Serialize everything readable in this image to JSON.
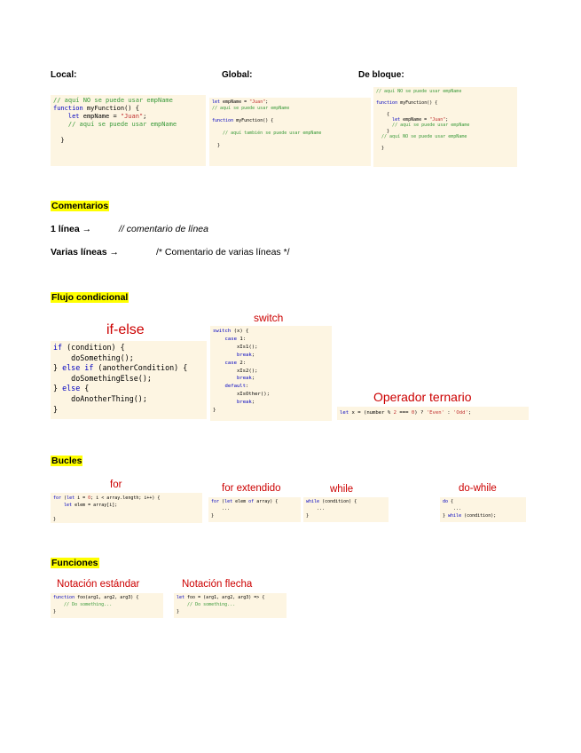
{
  "scope": {
    "local_label": "Local:",
    "global_label": "Global:",
    "block_label": "De bloque:",
    "local_code": {
      "l1": "// aquí NO se puede usar empName",
      "l2a": "function",
      "l2b": " myFunction() {",
      "l3a": "    let",
      "l3b": " empName = ",
      "l3c": "\"Juan\"",
      "l3d": ";",
      "l4": "    // aquí se puede usar empName",
      "l5": "  }"
    },
    "global_code": {
      "l1a": "let",
      "l1b": " empName = ",
      "l1c": "\"Juan\"",
      "l1d": ";",
      "l2": "// aquí se puede usar empName",
      "l3a": "function",
      "l3b": " myFunction() {",
      "l4": "    // aquí también se puede usar empName",
      "l5": "  }"
    },
    "block_code": {
      "l1": "// aquí NO se puede usar empName",
      "l2a": "function",
      "l2b": " myFunction() {",
      "l3": "    {",
      "l4a": "      let",
      "l4b": " empName = ",
      "l4c": "\"Juan\"",
      "l4d": ";",
      "l5": "      // aquí se puede usar empName",
      "l6": "    }",
      "l7": "  // aquí NO se puede usar empName",
      "l8": "  }"
    }
  },
  "comments": {
    "heading": "Comentarios",
    "single_label": "1 línea →",
    "single_example": "// comentario de línea",
    "multi_label": "Varias líneas →",
    "multi_example": "/* Comentario de varias líneas */"
  },
  "flow": {
    "heading": "Flujo condicional",
    "ifelse_title": "if-else",
    "ifelse_code": {
      "l1a": "if",
      "l1b": " (condition) {",
      "l2": "    doSomething();",
      "l3a": "} ",
      "l3b": "else if",
      "l3c": " (anotherCondition) {",
      "l4": "    doSomethingElse();",
      "l5a": "} ",
      "l5b": "else",
      "l5c": " {",
      "l6": "    doAnotherThing();",
      "l7": "}"
    },
    "switch_title": "switch",
    "switch_code": {
      "l1a": "switch",
      "l1b": " (x) {",
      "l2a": "    case",
      "l2b": " 1:",
      "l3": "        xIs1();",
      "l4a": "        ",
      "l4b": "break",
      "l4c": ";",
      "l5a": "    case",
      "l5b": " 2:",
      "l6": "        xIs2();",
      "l7a": "        ",
      "l7b": "break",
      "l7c": ";",
      "l8a": "    default",
      "l8b": ":",
      "l9": "        xIsOther();",
      "l10a": "        ",
      "l10b": "break",
      "l10c": ";",
      "l11": "}"
    },
    "ternary_title": "Operador ternario",
    "ternary_code": {
      "a": "let",
      "b": " x = (number % ",
      "c": "2",
      "d": " === ",
      "e": "0",
      "f": ") ? ",
      "g": "'Even'",
      "h": " : ",
      "i": "'Odd'",
      "j": ";"
    }
  },
  "loops": {
    "heading": "Bucles",
    "for_title": "for",
    "for_code": {
      "l1a": "for",
      "l1b": " (",
      "l1c": "let",
      "l1d": " i = ",
      "l1e": "0",
      "l1f": "; i < array.length; i++) {",
      "l2a": "    let",
      "l2b": " elem = array[i];",
      "l3": "}"
    },
    "forof_title": "for extendido",
    "forof_code": {
      "l1a": "for",
      "l1b": " (",
      "l1c": "let",
      "l1d": " elem ",
      "l1e": "of",
      "l1f": " array) {",
      "l2": "    ...",
      "l3": "}"
    },
    "while_title": "while",
    "while_code": {
      "l1a": "while",
      "l1b": " (condition) {",
      "l2": "    ...",
      "l3": "}"
    },
    "dowhile_title": "do-while",
    "dowhile_code": {
      "l1a": "do",
      "l1b": " {",
      "l2": "    ...",
      "l3a": "} ",
      "l3b": "while",
      "l3c": " (condition);"
    }
  },
  "functions": {
    "heading": "Funciones",
    "standard_title": "Notación estándar",
    "standard_code": {
      "l1a": "function",
      "l1b": " foo(arg1, arg2, arg3) {",
      "l2": "    // Do something...",
      "l3": "}"
    },
    "arrow_title": "Notación flecha",
    "arrow_code": {
      "l1a": "let",
      "l1b": " foo = (arg1, arg2, arg3) => {",
      "l2": "    // Do something...",
      "l3": "}"
    }
  },
  "colors": {
    "highlight": "#ffff00",
    "code_bg": "#fdf5e2",
    "keyword": "#0000c0",
    "comment": "#3a9a3a",
    "string": "#c03030",
    "title_red": "#cc0000"
  }
}
